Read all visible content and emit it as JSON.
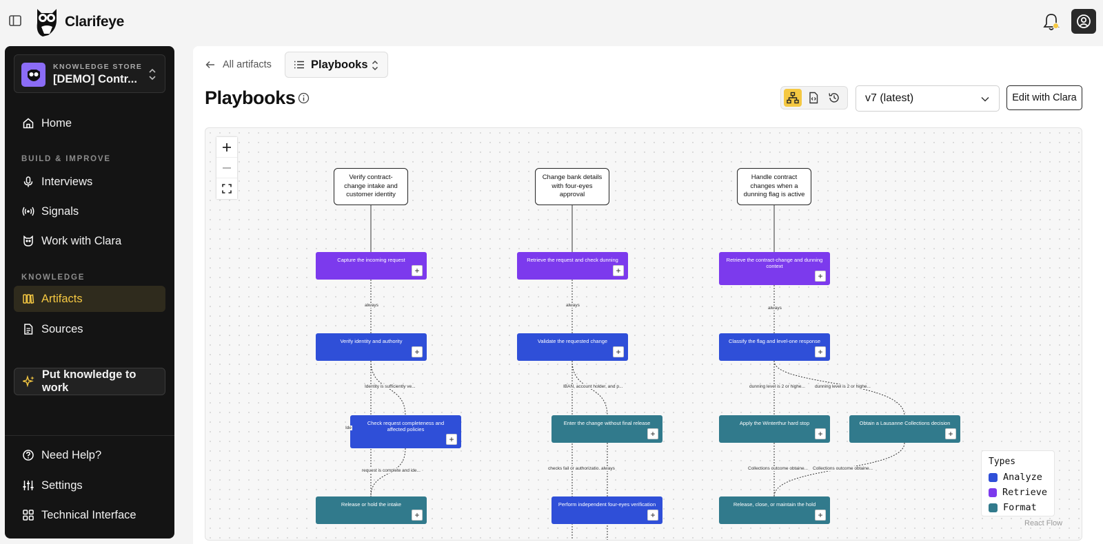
{
  "app": {
    "name": "Clarifeye"
  },
  "sidebar": {
    "store": {
      "kicker": "KNOWLEDGE STORE",
      "name": "[DEMO] Contr..."
    },
    "home": "Home",
    "section_build": "BUILD & IMPROVE",
    "interviews": "Interviews",
    "signals": "Signals",
    "work_with_clara": "Work with Clara",
    "section_knowledge": "KNOWLEDGE",
    "artifacts": "Artifacts",
    "sources": "Sources",
    "cta": "Put knowledge to work",
    "help": "Need Help?",
    "settings": "Settings",
    "technical": "Technical Interface"
  },
  "header": {
    "back": "All artifacts",
    "picker": "Playbooks",
    "title": "Playbooks",
    "version": "v7 (latest)",
    "edit": "Edit with Clara"
  },
  "flow": {
    "goals": [
      "Verify contract-change intake and customer identity",
      "Change bank details with four-eyes approval",
      "Handle contract changes when a dunning flag is active"
    ],
    "nodes": {
      "a1": "Capture the incoming request",
      "a2": "Verify identity and authority",
      "a3": "Check request completeness and affected policies",
      "a4": "Release or hold the intake",
      "b1": "Retrieve the request and check dunning",
      "b2": "Validate the requested change",
      "b3": "Enter the change without final release",
      "b4": "Perform independent four-eyes verification",
      "c1": "Retrieve the contract-change and dunning context",
      "c2": "Classify the flag and level-one response",
      "c3": "Apply the Winterthur hard stop",
      "c4": "Obtain a Lausanne Collections decision",
      "c5": "Release, close, or maintain the hold"
    },
    "edge_labels": {
      "a_always": "always",
      "a_identity": "Identity is sufficiently ve...",
      "a_side": "Ide",
      "a_complete": "request is complete and ide...",
      "b_always": "always",
      "b_iban": "IBAN, account holder, and p...",
      "b_checks": "checks fail or authorizatio...",
      "b_always2": "always",
      "c_always": "always",
      "c_dun1": "dunning level is 2 or highe...",
      "c_dun2": "dunning level is 2 or highe...",
      "c_coll1": "Collections outcome obtaine...",
      "c_coll2": "Collections outcome obtaine..."
    },
    "add_symbol": "+"
  },
  "legend": {
    "title": "Types",
    "items": [
      {
        "label": "Analyze",
        "color": "#2f4fd8"
      },
      {
        "label": "Retrieve",
        "color": "#7c3aed"
      },
      {
        "label": "Format",
        "color": "#317a8c"
      }
    ]
  },
  "attribution": "React Flow",
  "colors": {
    "accent": "#f5c842",
    "sidebar_bg": "#141414",
    "analyze": "#2f4fd8",
    "retrieve": "#7c3aed",
    "format": "#317a8c"
  }
}
